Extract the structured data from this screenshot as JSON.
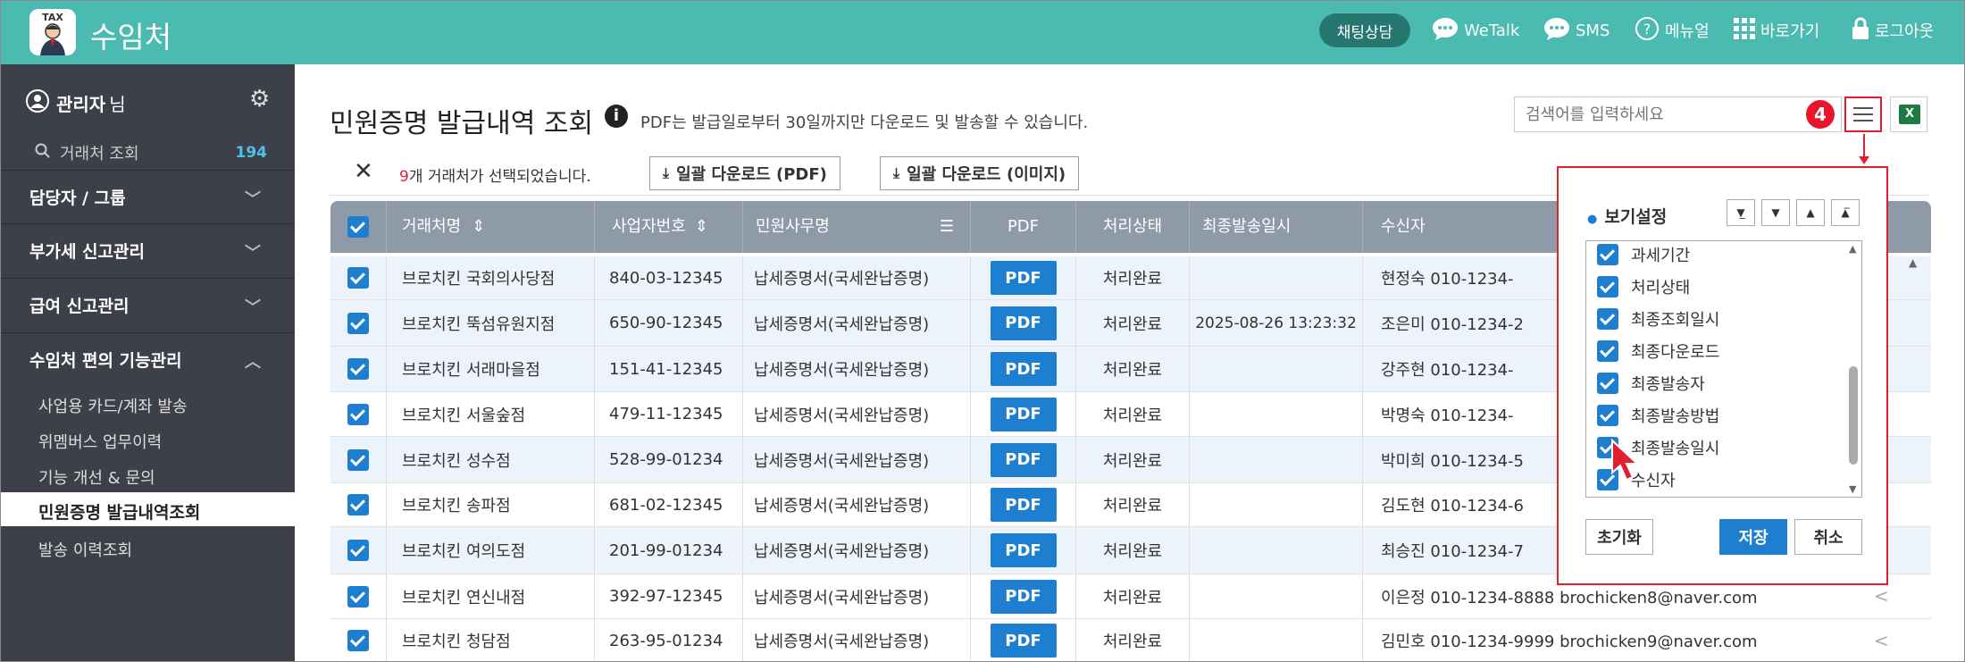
{
  "header": {
    "logo_text": "TAX",
    "app_title": "수임처",
    "chat_label": "채팅상담",
    "wetalk_label": "WeTalk",
    "sms_label": "SMS",
    "manual_label": "메뉴얼",
    "shortcut_label": "바로가기",
    "logout_label": "로그아웃"
  },
  "sidebar": {
    "admin_name": "관리자",
    "admin_suffix": "님",
    "client_search_label": "거래처 조회",
    "client_count": "194",
    "groups": [
      {
        "label": "담당자 / 그룹"
      },
      {
        "label": "부가세 신고관리"
      },
      {
        "label": "급여 신고관리"
      },
      {
        "label": "수임처 편의 기능관리"
      }
    ],
    "sub_items": [
      {
        "label": "사업용 카드/계좌 발송"
      },
      {
        "label": "위멤버스 업무이력"
      },
      {
        "label": "기능 개선 & 문의"
      },
      {
        "label": "민원증명 발급내역조회"
      },
      {
        "label": "발송 이력조회"
      }
    ]
  },
  "main": {
    "title": "민원증명 발급내역 조회",
    "note": "PDF는 발급일로부터 30일까지만 다운로드 및 발송할 수 있습니다.",
    "search_placeholder": "검색어를 입력하세요",
    "step_badge": "4",
    "excel_label": "X",
    "selection": {
      "count": "9",
      "text": "개 거래처가 선택되었습니다.",
      "btn_pdf": "일괄 다운로드 (PDF)",
      "btn_image": "일괄 다운로드 (이미지)"
    },
    "columns": {
      "name": "거래처명",
      "bizno": "사업자번호",
      "office": "민원사무명",
      "pdf": "PDF",
      "status": "처리상태",
      "sent": "최종발송일시",
      "recipient": "수신자"
    },
    "rows": [
      {
        "name": "브로치킨 국회의사당점",
        "bizno": "840-03-12345",
        "office": "납세증명서(국세완납증명)",
        "pdf": "PDF",
        "status": "처리완료",
        "sent": "",
        "recipient": "현정숙 010-1234-"
      },
      {
        "name": "브로치킨 뚝섬유원지점",
        "bizno": "650-90-12345",
        "office": "납세증명서(국세완납증명)",
        "pdf": "PDF",
        "status": "처리완료",
        "sent": "2025-08-26 13:23:32",
        "recipient": "조은미 010-1234-2"
      },
      {
        "name": "브로치킨 서래마을점",
        "bizno": "151-41-12345",
        "office": "납세증명서(국세완납증명)",
        "pdf": "PDF",
        "status": "처리완료",
        "sent": "",
        "recipient": "강주현 010-1234-"
      },
      {
        "name": "브로치킨 서울숲점",
        "bizno": "479-11-12345",
        "office": "납세증명서(국세완납증명)",
        "pdf": "PDF",
        "status": "처리완료",
        "sent": "",
        "recipient": "박명숙 010-1234-"
      },
      {
        "name": "브로치킨 성수점",
        "bizno": "528-99-01234",
        "office": "납세증명서(국세완납증명)",
        "pdf": "PDF",
        "status": "처리완료",
        "sent": "",
        "recipient": "박미희 010-1234-5"
      },
      {
        "name": "브로치킨 송파점",
        "bizno": "681-02-12345",
        "office": "납세증명서(국세완납증명)",
        "pdf": "PDF",
        "status": "처리완료",
        "sent": "",
        "recipient": "김도현 010-1234-6"
      },
      {
        "name": "브로치킨 여의도점",
        "bizno": "201-99-01234",
        "office": "납세증명서(국세완납증명)",
        "pdf": "PDF",
        "status": "처리완료",
        "sent": "",
        "recipient": "최승진 010-1234-7"
      },
      {
        "name": "브로치킨 연신내점",
        "bizno": "392-97-12345",
        "office": "납세증명서(국세완납증명)",
        "pdf": "PDF",
        "status": "처리완료",
        "sent": "",
        "recipient": "이은정 010-1234-8888 brochicken8@naver.com"
      },
      {
        "name": "브로치킨 청담점",
        "bizno": "263-95-01234",
        "office": "납세증명서(국세완납증명)",
        "pdf": "PDF",
        "status": "처리완료",
        "sent": "",
        "recipient": "김민호 010-1234-9999 brochicken9@naver.com"
      }
    ]
  },
  "popup": {
    "title": "보기설정",
    "items": [
      {
        "label": "과세기간"
      },
      {
        "label": "처리상태"
      },
      {
        "label": "최종조회일시"
      },
      {
        "label": "최종다운로드"
      },
      {
        "label": "최종발송자"
      },
      {
        "label": "최종발송방법"
      },
      {
        "label": "최종발송일시"
      },
      {
        "label": "수신자"
      }
    ],
    "reset_label": "초기화",
    "save_label": "저장",
    "cancel_label": "취소"
  },
  "colors": {
    "header_bg": "#4bbab0",
    "sidebar_bg": "#3e4049",
    "accent_blue": "#1e7fd0",
    "highlight_red": "#e02030",
    "table_head": "#8f9aa8"
  }
}
